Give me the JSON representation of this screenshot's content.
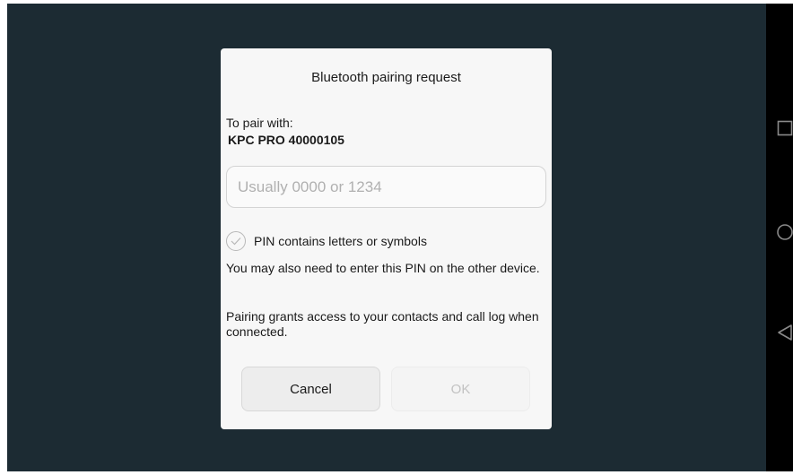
{
  "dialog": {
    "title": "Bluetooth pairing request",
    "pair_label": "To pair with:",
    "device_name": "KPC PRO 40000105",
    "pin_input": {
      "value": "",
      "placeholder": "Usually 0000 or 1234"
    },
    "pin_letters_checkbox": {
      "label": "PIN contains letters or symbols",
      "checked": false
    },
    "info_pin_other_device": "You may also need to enter this PIN on the other device.",
    "info_access": "Pairing grants access to your contacts and call log when connected.",
    "cancel_label": "Cancel",
    "ok_label": "OK",
    "ok_enabled": false
  },
  "navbar": {
    "icons": [
      "recent-apps-icon",
      "home-icon",
      "back-icon"
    ]
  },
  "colors": {
    "screen_background": "#1c2b33",
    "dialog_background": "#f7f7f7",
    "navbar_background": "#000000",
    "disabled_text": "#c2c2c2"
  }
}
